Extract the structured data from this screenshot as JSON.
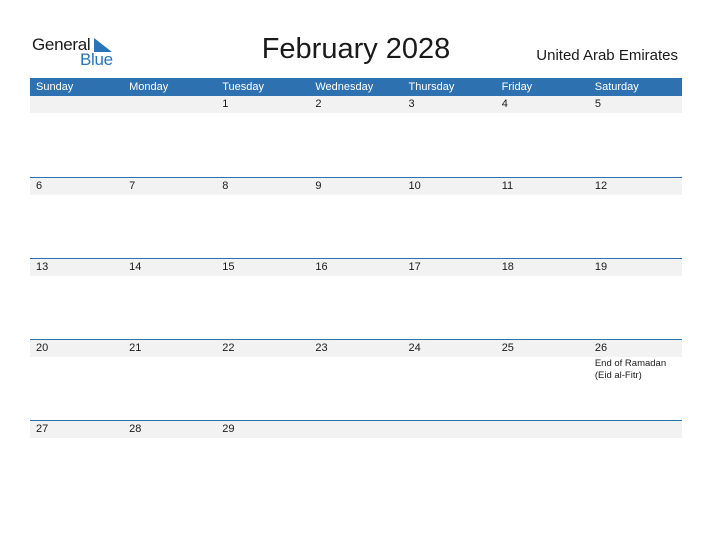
{
  "logo": {
    "line1": "General",
    "line2": "Blue"
  },
  "title": "February 2028",
  "country": "United Arab Emirates",
  "colors": {
    "header_bg": "#2e71b0",
    "strip_bg": "#f2f2f2",
    "brand_blue": "#2a74b8"
  },
  "weekdays": [
    "Sunday",
    "Monday",
    "Tuesday",
    "Wednesday",
    "Thursday",
    "Friday",
    "Saturday"
  ],
  "weeks": [
    {
      "days": [
        "",
        "",
        "1",
        "2",
        "3",
        "4",
        "5"
      ],
      "events": [
        "",
        "",
        "",
        "",
        "",
        "",
        ""
      ]
    },
    {
      "days": [
        "6",
        "7",
        "8",
        "9",
        "10",
        "11",
        "12"
      ],
      "events": [
        "",
        "",
        "",
        "",
        "",
        "",
        ""
      ]
    },
    {
      "days": [
        "13",
        "14",
        "15",
        "16",
        "17",
        "18",
        "19"
      ],
      "events": [
        "",
        "",
        "",
        "",
        "",
        "",
        ""
      ]
    },
    {
      "days": [
        "20",
        "21",
        "22",
        "23",
        "24",
        "25",
        "26"
      ],
      "events": [
        "",
        "",
        "",
        "",
        "",
        "",
        "End of Ramadan (Eid al-Fitr)"
      ]
    },
    {
      "days": [
        "27",
        "28",
        "29",
        "",
        "",
        "",
        ""
      ],
      "events": [
        "",
        "",
        "",
        "",
        "",
        "",
        ""
      ]
    }
  ]
}
